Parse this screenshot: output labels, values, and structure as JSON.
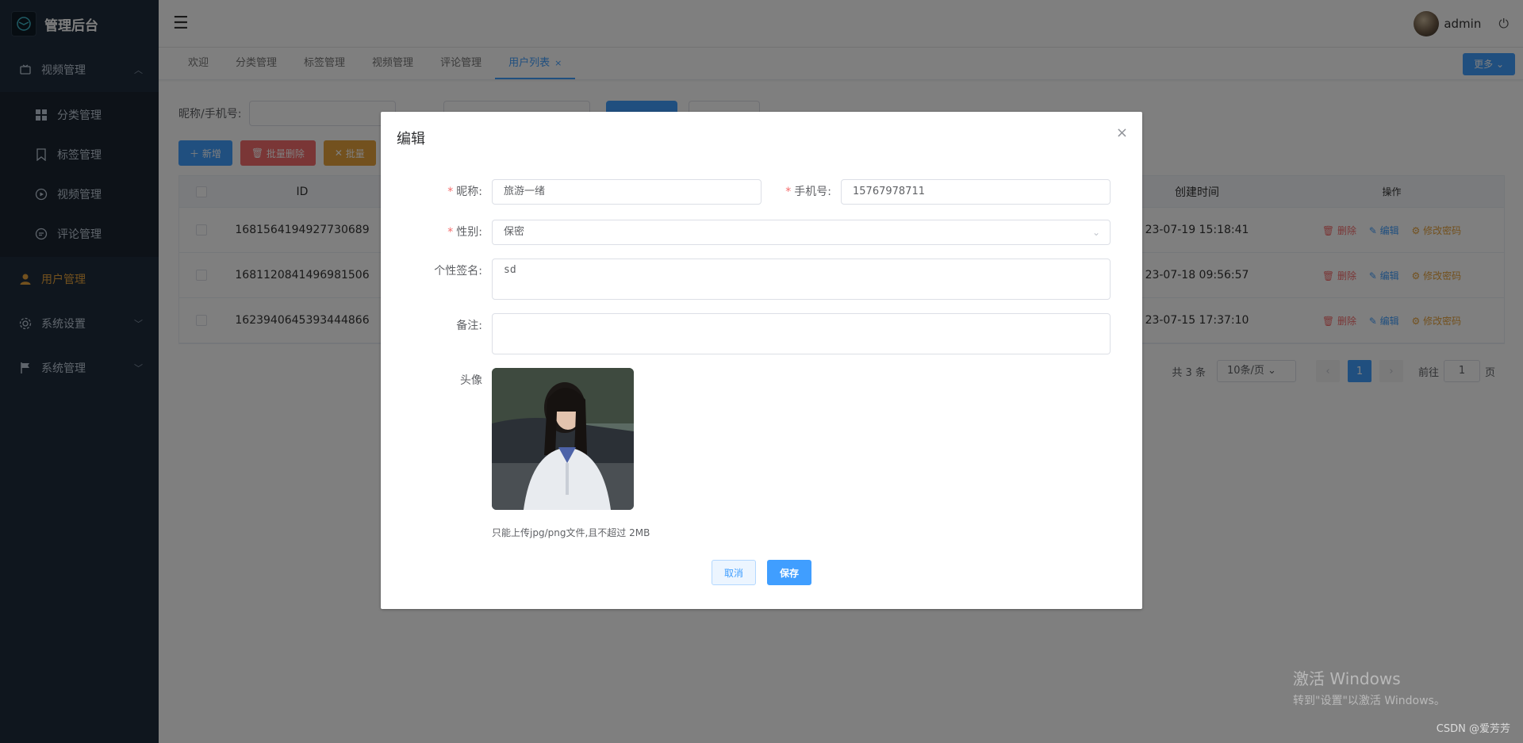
{
  "brand": {
    "title": "管理后台"
  },
  "sidebar": {
    "video_group": "视频管理",
    "sub_items": [
      {
        "label": "分类管理"
      },
      {
        "label": "标签管理"
      },
      {
        "label": "视频管理"
      },
      {
        "label": "评论管理"
      }
    ],
    "user_mgmt": "用户管理",
    "system_settings": "系统设置",
    "system_mgmt": "系统管理"
  },
  "header": {
    "username": "admin"
  },
  "tabs": [
    {
      "label": "欢迎"
    },
    {
      "label": "分类管理"
    },
    {
      "label": "标签管理"
    },
    {
      "label": "视频管理"
    },
    {
      "label": "评论管理"
    },
    {
      "label": "用户列表",
      "close": "×"
    }
  ],
  "more_label": "更多",
  "search": {
    "label": "昵称/手机号:"
  },
  "toolbar": {
    "add": "新增",
    "batch_delete": "批量删除",
    "batch_other": "批量"
  },
  "table": {
    "headers": {
      "id": "ID",
      "created": "创建时间",
      "ops": "操作"
    },
    "rows": [
      {
        "id": "1681564194927730689",
        "created": "23-07-19 15:18:41"
      },
      {
        "id": "1681120841496981506",
        "created": "23-07-18 09:56:57"
      },
      {
        "id": "1623940645393444866",
        "created": "23-07-15 17:37:10"
      }
    ],
    "ops": {
      "delete": "删除",
      "edit": "编辑",
      "change_pwd": "修改密码"
    }
  },
  "pagination": {
    "total": "共 3 条",
    "page_size": "10条/页",
    "current": "1",
    "goto_prefix": "前往",
    "goto_value": "1",
    "goto_suffix": "页"
  },
  "dialog": {
    "title": "编辑",
    "close": "×",
    "nickname_label": "昵称:",
    "nickname_value": "旅游一绪",
    "phone_label": "手机号:",
    "phone_value": "15767978711",
    "gender_label": "性别:",
    "gender_value": "保密",
    "signature_label": "个性签名:",
    "signature_value": "sd",
    "remark_label": "备注:",
    "remark_value": "",
    "avatar_label": "头像",
    "upload_hint": "只能上传jpg/png文件,且不超过 2MB",
    "cancel": "取消",
    "save": "保存"
  },
  "watermark": {
    "line1": "激活 Windows",
    "line2": "转到\"设置\"以激活 Windows。"
  },
  "csdn": "CSDN @爱芳芳",
  "colors": {
    "primary": "#409eff",
    "danger": "#f56c6c",
    "warning": "#e6a23c",
    "sidebar_bg": "#1f2d3d"
  }
}
